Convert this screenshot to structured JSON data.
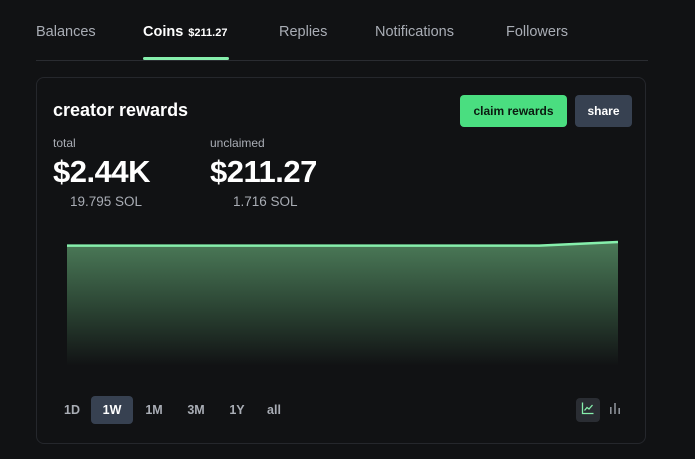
{
  "tabs": [
    {
      "label": "Balances"
    },
    {
      "label": "Coins",
      "badge": "$211.27"
    },
    {
      "label": "Replies"
    },
    {
      "label": "Notifications"
    },
    {
      "label": "Followers"
    }
  ],
  "card": {
    "title": "creator rewards",
    "claim_label": "claim rewards",
    "share_label": "share",
    "total": {
      "label": "total",
      "value": "$2.44K",
      "sub": "19.795 SOL"
    },
    "unclaimed": {
      "label": "unclaimed",
      "value": "$211.27",
      "sub": "1.716 SOL"
    }
  },
  "ranges": [
    "1D",
    "1W",
    "1M",
    "3M",
    "1Y",
    "all"
  ],
  "selected_range": "1W",
  "view_icons": [
    "line-chart-icon",
    "bar-chart-icon"
  ],
  "colors": {
    "accent": "#4ade80",
    "line": "#86efac",
    "background": "#111214",
    "button_dark": "#374151"
  },
  "chart_data": {
    "type": "area",
    "x": [
      0,
      1,
      2,
      3,
      4,
      5,
      6,
      7
    ],
    "values": [
      1,
      1,
      1,
      1,
      1,
      1,
      1,
      1.03
    ]
  }
}
